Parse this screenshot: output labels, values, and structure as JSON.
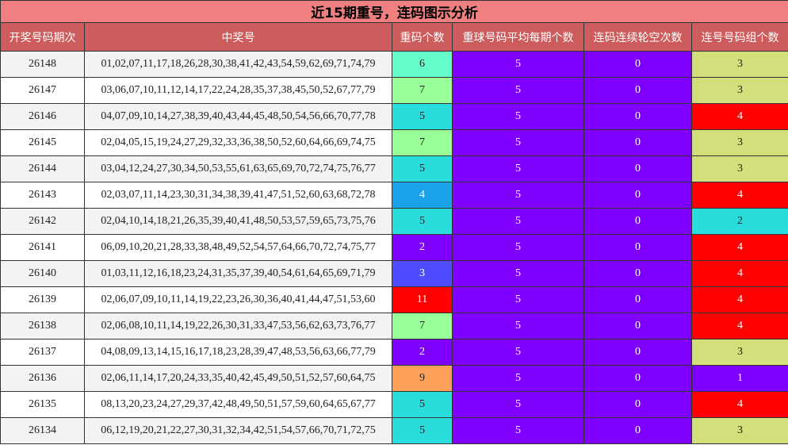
{
  "title": "近15期重号，连码图示分析",
  "headers": [
    "开奖号码期次",
    "中奖号",
    "重码个数",
    "重球号码平均每期个数",
    "连码连续轮空次数",
    "连号号码组个数"
  ],
  "colors": {
    "repeat": {
      "2": "#8000ff",
      "3": "#4d4dff",
      "4": "#1aa3e8",
      "5": "#2adddd",
      "6": "#66ffcc",
      "7": "#99ff99",
      "9": "#ffa15a",
      "11": "#ff0000"
    },
    "avg": "#8000ff",
    "gap": "#8000ff",
    "consec": {
      "1": "#8000ff",
      "2": "#2adddd",
      "3": "#d4de7a",
      "4": "#ff0000"
    }
  },
  "rows": [
    {
      "period": "26148",
      "numbers": "01,02,07,11,17,18,26,28,30,38,41,42,43,54,59,62,69,71,74,79",
      "repeat": "6",
      "avg": "5",
      "gap": "0",
      "consec": "3"
    },
    {
      "period": "26147",
      "numbers": "03,06,07,10,11,12,14,17,22,24,28,35,37,38,45,50,52,67,77,79",
      "repeat": "7",
      "avg": "5",
      "gap": "0",
      "consec": "3"
    },
    {
      "period": "26146",
      "numbers": "04,07,09,10,14,27,38,39,40,43,44,45,48,50,54,56,66,70,77,78",
      "repeat": "5",
      "avg": "5",
      "gap": "0",
      "consec": "4"
    },
    {
      "period": "26145",
      "numbers": "02,04,05,15,19,24,27,29,32,33,36,38,50,52,60,64,66,69,74,75",
      "repeat": "7",
      "avg": "5",
      "gap": "0",
      "consec": "3"
    },
    {
      "period": "26144",
      "numbers": "03,04,12,24,27,30,34,50,53,55,61,63,65,69,70,72,74,75,76,77",
      "repeat": "5",
      "avg": "5",
      "gap": "0",
      "consec": "3"
    },
    {
      "period": "26143",
      "numbers": "02,03,07,11,14,23,30,31,34,38,39,41,47,51,52,60,63,68,72,78",
      "repeat": "4",
      "avg": "5",
      "gap": "0",
      "consec": "4"
    },
    {
      "period": "26142",
      "numbers": "02,04,10,14,18,21,26,35,39,40,41,48,50,53,57,59,65,73,75,76",
      "repeat": "5",
      "avg": "5",
      "gap": "0",
      "consec": "2"
    },
    {
      "period": "26141",
      "numbers": "06,09,10,20,21,28,33,38,48,49,52,54,57,64,66,70,72,74,75,77",
      "repeat": "2",
      "avg": "5",
      "gap": "0",
      "consec": "4"
    },
    {
      "period": "26140",
      "numbers": "01,03,11,12,16,18,23,24,31,35,37,39,40,54,61,64,65,69,71,79",
      "repeat": "3",
      "avg": "5",
      "gap": "0",
      "consec": "4"
    },
    {
      "period": "26139",
      "numbers": "02,06,07,09,10,11,14,19,22,23,26,30,36,40,41,44,47,51,53,60",
      "repeat": "11",
      "avg": "5",
      "gap": "0",
      "consec": "4"
    },
    {
      "period": "26138",
      "numbers": "02,06,08,10,11,14,19,22,26,30,31,33,47,53,56,62,63,73,76,77",
      "repeat": "7",
      "avg": "5",
      "gap": "0",
      "consec": "4"
    },
    {
      "period": "26137",
      "numbers": "04,08,09,13,14,15,16,17,18,23,28,39,47,48,53,56,63,66,77,79",
      "repeat": "2",
      "avg": "5",
      "gap": "0",
      "consec": "3"
    },
    {
      "period": "26136",
      "numbers": "02,06,11,14,17,20,24,33,35,40,42,45,49,50,51,52,57,60,64,75",
      "repeat": "9",
      "avg": "5",
      "gap": "0",
      "consec": "1"
    },
    {
      "period": "26135",
      "numbers": "08,13,20,23,24,27,29,37,42,48,49,50,51,57,59,60,64,65,67,77",
      "repeat": "5",
      "avg": "5",
      "gap": "0",
      "consec": "4"
    },
    {
      "period": "26134",
      "numbers": "06,12,19,20,21,22,27,30,31,32,34,42,51,54,57,66,70,71,72,75",
      "repeat": "5",
      "avg": "5",
      "gap": "0",
      "consec": "3"
    }
  ]
}
